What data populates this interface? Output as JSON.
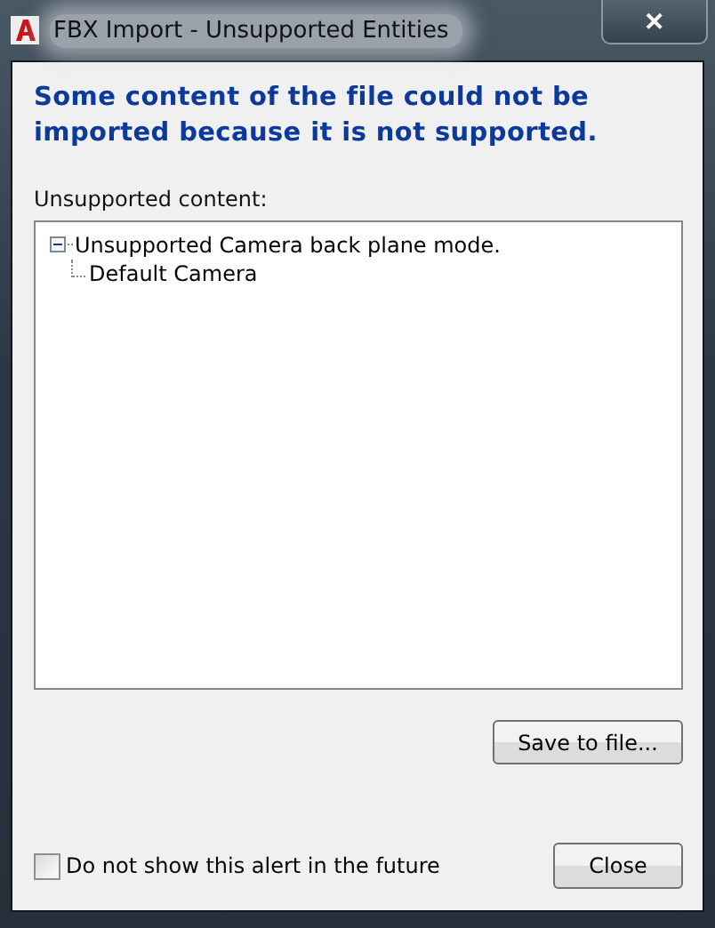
{
  "window": {
    "title": "FBX Import - Unsupported Entities",
    "close_glyph": "✕"
  },
  "heading": "Some content of the file could not be imported because it is not supported.",
  "list_label": "Unsupported content:",
  "tree": [
    {
      "label": "Unsupported Camera back plane mode.",
      "expanded": true,
      "children": [
        {
          "label": "Default Camera"
        }
      ]
    }
  ],
  "save_button": "Save to file...",
  "checkbox": {
    "label": "Do not show this alert in the future",
    "checked": false
  },
  "close_button": "Close"
}
